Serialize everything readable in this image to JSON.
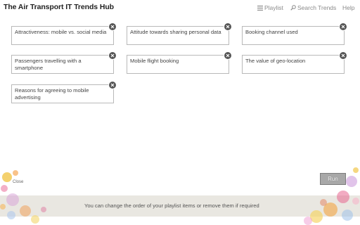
{
  "header": {
    "title": "The Air Transport IT Trends Hub",
    "nav": {
      "playlist": "Playlist",
      "search_trends": "Search Trends",
      "help": "Help"
    }
  },
  "playlist": {
    "items": [
      {
        "label": "Attractiveness: mobile vs. social media"
      },
      {
        "label": "Attitude towards sharing personal data"
      },
      {
        "label": "Booking channel used"
      },
      {
        "label": "Passengers travelling with a smartphone"
      },
      {
        "label": "Mobile flight booking"
      },
      {
        "label": "The value of geo-location"
      },
      {
        "label": "Reasons for agreeing to mobile advertising"
      }
    ]
  },
  "actions": {
    "run_label": "Run",
    "close_label": "Close"
  },
  "footer": {
    "message": "You can change the order of your playlist items or remove them if required"
  },
  "icons": {
    "playlist": "list-icon",
    "search": "search-icon",
    "remove": "close-icon"
  },
  "colors": {
    "card_border": "#b9b9b9",
    "close_badge": "#555555",
    "run_button": "#a8a8a8",
    "footer_band": "#e9e7e1"
  }
}
